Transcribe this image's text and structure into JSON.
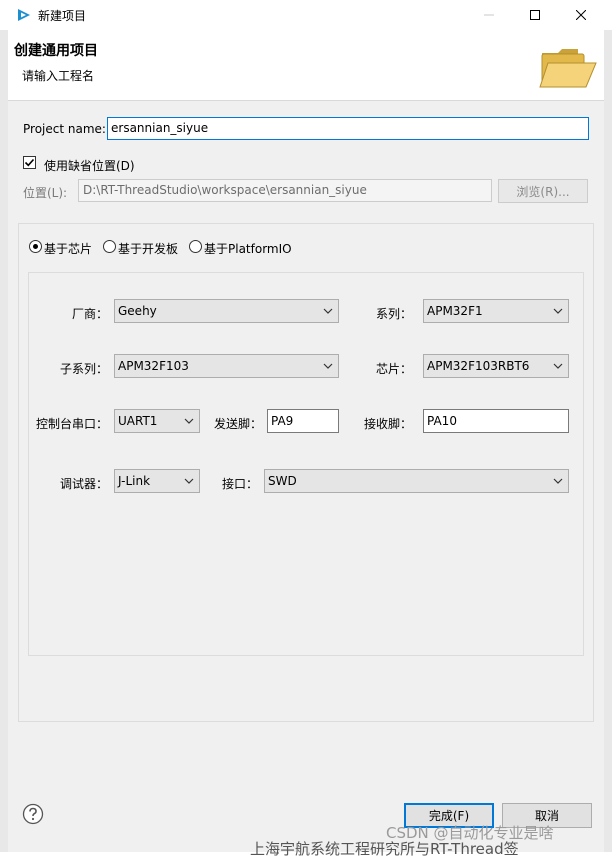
{
  "window": {
    "title": "新建项目"
  },
  "header": {
    "title": "创建通用项目",
    "subtitle": "请输入工程名"
  },
  "project": {
    "name_label": "Project name:",
    "name_value": "ersannian_siyue",
    "use_default_label": "使用缺省位置(D)",
    "use_default_checked": true,
    "location_label": "位置(L):",
    "location_value": "D:\\RT-ThreadStudio\\workspace\\ersannian_siyue",
    "browse_label": "浏览(R)..."
  },
  "base_options": [
    {
      "label": "基于芯片",
      "selected": true
    },
    {
      "label": "基于开发板",
      "selected": false
    },
    {
      "label": "基于PlatformIO",
      "selected": false
    }
  ],
  "form": {
    "vendor_label": "厂商：",
    "vendor_value": "Geehy",
    "series_label": "系列：",
    "series_value": "APM32F1",
    "subseries_label": "子系列：",
    "subseries_value": "APM32F103",
    "chip_label": "芯片：",
    "chip_value": "APM32F103RBT6",
    "console_label": "控制台串口：",
    "console_value": "UART1",
    "tx_label": "发送脚：",
    "tx_value": "PA9",
    "rx_label": "接收脚：",
    "rx_value": "PA10",
    "debugger_label": "调试器：",
    "debugger_value": "J-Link",
    "interface_label": "接口：",
    "interface_value": "SWD"
  },
  "footer": {
    "finish_label": "完成(F)",
    "cancel_label": "取消"
  },
  "overlay": {
    "watermark": "CSDN @自动化专业是啥",
    "background_text": "上海宇航系统工程研究所与RT-Thread签"
  },
  "colors": {
    "accent": "#0078d7",
    "panel_bg": "#f0f0f0"
  }
}
